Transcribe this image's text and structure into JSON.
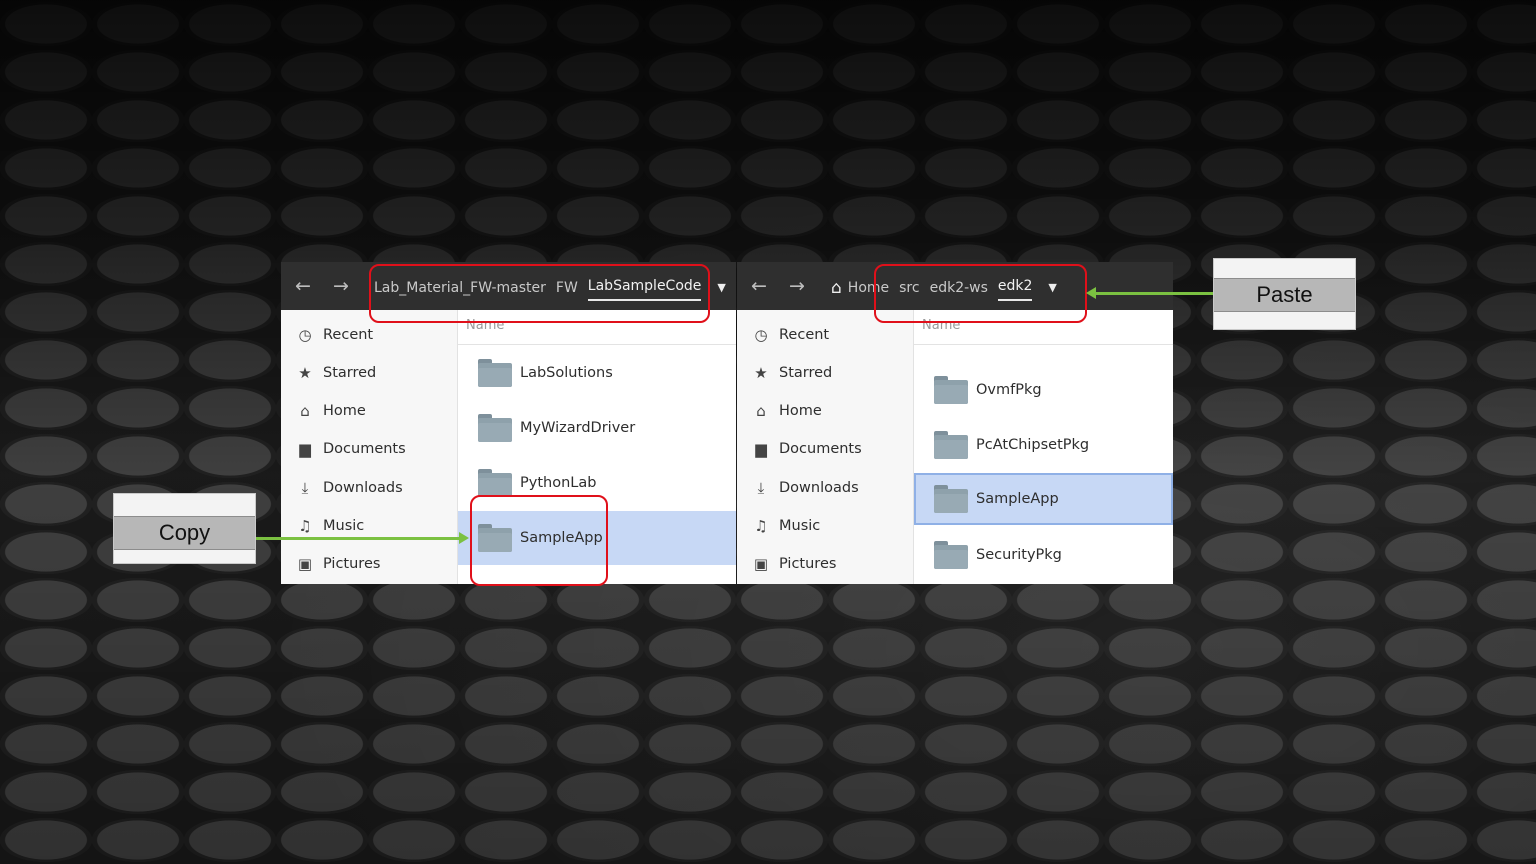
{
  "left_window": {
    "breadcrumb": [
      "Lab_Material_FW-master",
      "FW"
    ],
    "breadcrumb_active": "LabSampleCode",
    "caret": "▼",
    "back_icon": "←",
    "forward_icon": "→",
    "sidebar": [
      {
        "label": "Recent",
        "icon": "◷"
      },
      {
        "label": "Starred",
        "icon": "★"
      },
      {
        "label": "Home",
        "icon": "⌂"
      },
      {
        "label": "Documents",
        "icon": "▆"
      },
      {
        "label": "Downloads",
        "icon": "⤓"
      },
      {
        "label": "Music",
        "icon": "♫"
      },
      {
        "label": "Pictures",
        "icon": "▣"
      }
    ],
    "column_header": "Name",
    "files": [
      "LabSolutions",
      "MyWizardDriver",
      "PythonLab",
      "SampleApp"
    ],
    "selected": "SampleApp"
  },
  "right_window": {
    "home_icon": "⌂",
    "breadcrumb": [
      "Home",
      "src",
      "edk2-ws"
    ],
    "breadcrumb_active": "edk2",
    "caret": "▼",
    "back_icon": "←",
    "forward_icon": "→",
    "sidebar": [
      {
        "label": "Recent",
        "icon": "◷"
      },
      {
        "label": "Starred",
        "icon": "★"
      },
      {
        "label": "Home",
        "icon": "⌂"
      },
      {
        "label": "Documents",
        "icon": "▆"
      },
      {
        "label": "Downloads",
        "icon": "⤓"
      },
      {
        "label": "Music",
        "icon": "♫"
      },
      {
        "label": "Pictures",
        "icon": "▣"
      }
    ],
    "column_header": "Name",
    "files": [
      "OvmfPkg",
      "PcAtChipsetPkg",
      "SampleApp",
      "SecurityPkg"
    ],
    "selected": "SampleApp"
  },
  "annotations": {
    "copy_label": "Copy",
    "paste_label": "Paste",
    "highlight_color": "#e0101a",
    "arrow_color": "#7bc141"
  }
}
